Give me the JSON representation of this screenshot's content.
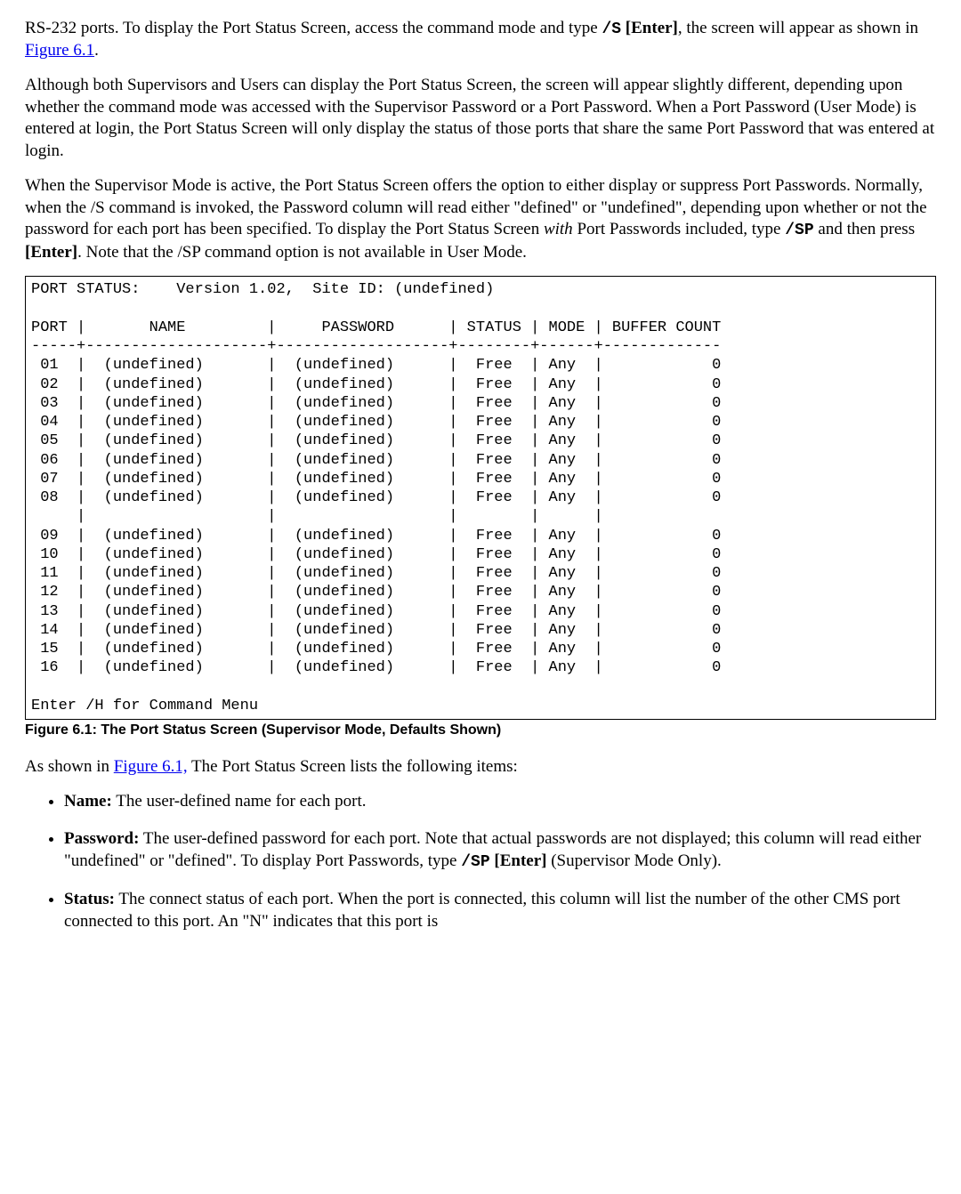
{
  "para1": {
    "lead": "RS-232 ports. To display the Port Status Screen, access the command mode and type ",
    "code": "/S",
    "mid": " ",
    "bold": "[Enter]",
    "after": ", the screen will appear as shown in ",
    "link": "Figure 6.1",
    "end": "."
  },
  "para2": "Although both Supervisors and Users can display the Port Status Screen, the screen will appear slightly different, depending upon whether the command mode was accessed with the Supervisor Password or a Port Password. When a Port Password (User Mode) is entered at login, the Port Status Screen will only display the status of those ports that share the same Port Password that was entered at login.",
  "para3": {
    "t1": "When the Supervisor Mode is active, the Port Status Screen offers the option to either display or suppress Port Passwords. Normally, when the /S command is invoked, the Password column will read either \"defined\" or \"undefined\", depending upon whether or not the password for each port has been specified. To display the Port Status Screen ",
    "it": "with",
    "t2": " Port Passwords included, type ",
    "code": "/SP",
    "t3": " and then press ",
    "bold": "[Enter]",
    "t4": ". Note that the /SP command option is not available in User Mode."
  },
  "terminal": "PORT STATUS:    Version 1.02,  Site ID: (undefined)\n\nPORT |       NAME         |     PASSWORD      | STATUS | MODE | BUFFER COUNT\n-----+--------------------+-------------------+--------+------+-------------\n 01  |  (undefined)       |  (undefined)      |  Free  | Any  |            0\n 02  |  (undefined)       |  (undefined)      |  Free  | Any  |            0\n 03  |  (undefined)       |  (undefined)      |  Free  | Any  |            0\n 04  |  (undefined)       |  (undefined)      |  Free  | Any  |            0\n 05  |  (undefined)       |  (undefined)      |  Free  | Any  |            0\n 06  |  (undefined)       |  (undefined)      |  Free  | Any  |            0\n 07  |  (undefined)       |  (undefined)      |  Free  | Any  |            0\n 08  |  (undefined)       |  (undefined)      |  Free  | Any  |            0\n     |                    |                   |        |      |\n 09  |  (undefined)       |  (undefined)      |  Free  | Any  |            0\n 10  |  (undefined)       |  (undefined)      |  Free  | Any  |            0\n 11  |  (undefined)       |  (undefined)      |  Free  | Any  |            0\n 12  |  (undefined)       |  (undefined)      |  Free  | Any  |            0\n 13  |  (undefined)       |  (undefined)      |  Free  | Any  |            0\n 14  |  (undefined)       |  (undefined)      |  Free  | Any  |            0\n 15  |  (undefined)       |  (undefined)      |  Free  | Any  |            0\n 16  |  (undefined)       |  (undefined)      |  Free  | Any  |            0\n\nEnter /H for Command Menu",
  "caption": "Figure 6.1:   The Port Status Screen (Supervisor Mode, Defaults Shown)",
  "para4": {
    "t1": "As shown in ",
    "link": "Figure 6.1,",
    "t2": " The Port Status Screen lists the following items:"
  },
  "bullets": {
    "name": {
      "label": "Name:",
      "text": "  The user-defined name for each port."
    },
    "password": {
      "label": "Password:",
      "text1": "  The user-defined password for each port. Note that actual passwords are not displayed; this column will read either \"undefined\" or \"defined\". To display Port Passwords, type ",
      "code": "/SP",
      "mid": " ",
      "bold": "[Enter]",
      "text2": " (Supervisor Mode Only)."
    },
    "status": {
      "label": "Status:",
      "text": "  The connect status of each port. When the port is connected, this column will list the number of the other CMS port connected to this port. An \"N\" indicates that this port is"
    }
  }
}
